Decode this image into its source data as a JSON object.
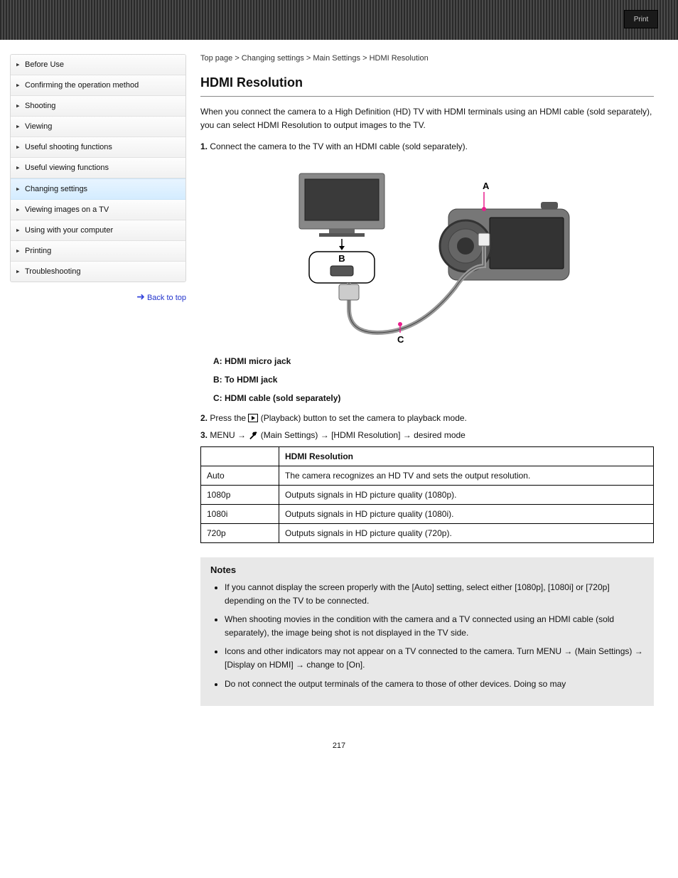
{
  "header": {
    "print": "Print"
  },
  "sidebar": {
    "items": [
      {
        "label": "Before Use"
      },
      {
        "label": "Confirming the operation method"
      },
      {
        "label": "Shooting"
      },
      {
        "label": "Viewing"
      },
      {
        "label": "Useful shooting functions"
      },
      {
        "label": "Useful viewing functions"
      },
      {
        "label": "Changing settings"
      },
      {
        "label": "Viewing images on a TV"
      },
      {
        "label": "Using with your computer"
      },
      {
        "label": "Printing"
      },
      {
        "label": "Troubleshooting"
      }
    ],
    "active_index": 6,
    "back_top": "Back to top"
  },
  "content": {
    "breadcrumb": "Top page > Changing settings > Main Settings > HDMI Resolution",
    "title": "HDMI Resolution",
    "intro": "When you connect the camera to a High Definition (HD) TV with HDMI terminals using an HDMI cable (sold separately), you can select HDMI Resolution to output images to the TV.",
    "step1_num": "1.",
    "step1_text": " Connect the camera to the TV with an HDMI cable (sold separately).",
    "label_a": "A: HDMI micro jack",
    "label_b": "B: To HDMI jack",
    "label_c": "C: HDMI cable (sold separately)",
    "step2_num": "2.",
    "step2_pre": " Press the ",
    "step2_post": " (Playback) button to set the camera to playback mode.",
    "step3_num": "3.",
    "step3_a": " MENU ",
    "step3_b": " (Main Settings) ",
    "step3_c": " [HDMI Resolution] ",
    "step3_d": " desired mode",
    "table": {
      "th1": "",
      "th2": "HDMI Resolution",
      "rows": [
        {
          "c1": "Auto",
          "c2": "The camera recognizes an HD TV and sets the output resolution."
        },
        {
          "c1": "1080p",
          "c2": "Outputs signals in HD picture quality (1080p)."
        },
        {
          "c1": "1080i",
          "c2": "Outputs signals in HD picture quality (1080i)."
        },
        {
          "c1": "720p",
          "c2": "Outputs signals in HD picture quality (720p)."
        }
      ]
    },
    "notes_title": "Notes",
    "notes": [
      "If you cannot display the screen properly with the [Auto] setting, select either [1080p], [1080i] or [720p] depending on the TV to be connected.",
      "When shooting movies in the condition with the camera and a TV connected using an HDMI cable (sold separately), the image being shot is not displayed in the TV side.",
      "Icons and other indicators may not appear on a TV connected to the camera. Turn MENU →  (Main Settings) → [Display on HDMI] → change to [On].",
      "Do not connect the output terminals of the camera to those of other devices. Doing so may"
    ],
    "page_number": "217"
  }
}
